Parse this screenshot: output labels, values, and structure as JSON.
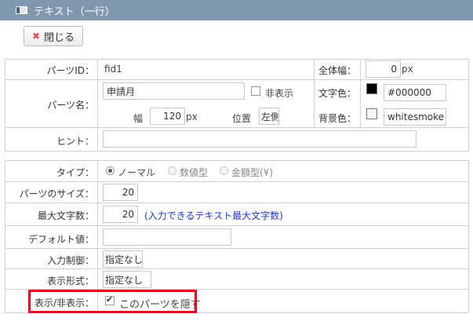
{
  "window": {
    "title": "テキスト（一行）"
  },
  "toolbar": {
    "close_label": "閉じる"
  },
  "form": {
    "part_id_label": "パーツID：",
    "part_id_value": "fid1",
    "total_width_label": "全体幅：",
    "total_width_value": "0",
    "total_width_unit": "px",
    "part_name_label": "パーツ名：",
    "part_name_value": "申請月",
    "hidden_label": "非表示",
    "text_color_label": "文字色：",
    "text_color_value": "#000000",
    "text_color_swatch": "#000000",
    "width_label": "幅",
    "width_value": "120",
    "width_unit": "px",
    "position_label": "位置",
    "position_value": "左側",
    "bg_color_label": "背景色：",
    "bg_color_value": "whitesmoke",
    "bg_color_swatch": "#f5f5f5",
    "hint_label": "ヒント：",
    "hint_value": "",
    "type_label": "タイプ：",
    "type_options": [
      "ノーマル",
      "数値型",
      "金額型(¥)"
    ],
    "type_selected": "ノーマル",
    "size_label": "パーツのサイズ：",
    "size_value": "20",
    "maxlen_label": "最大文字数：",
    "maxlen_value": "20",
    "maxlen_note": "(入力できるテキスト最大文字数)",
    "default_label": "デフォルト値：",
    "default_value": "",
    "input_restrict_label": "入力制御：",
    "input_restrict_value": "指定なし",
    "display_format_label": "表示形式：",
    "display_format_value": "指定なし",
    "visibility_label": "表示/非表示：",
    "visibility_checkbox_label": "このパーツを隠す",
    "visibility_checked": true
  },
  "colors": {
    "titlebar": "#8197ad",
    "highlight": "#e8001e",
    "note": "#2233cc"
  }
}
